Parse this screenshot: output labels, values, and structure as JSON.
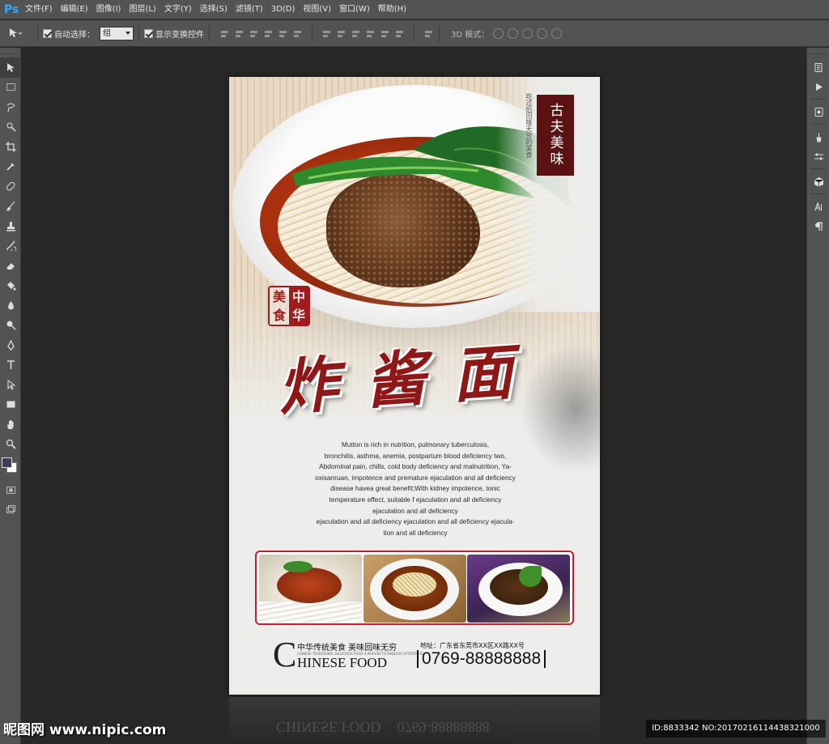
{
  "app": {
    "logo": "Ps"
  },
  "menu": [
    "文件(F)",
    "编辑(E)",
    "图像(I)",
    "图层(L)",
    "文字(Y)",
    "选择(S)",
    "滤镜(T)",
    "3D(D)",
    "视图(V)",
    "窗口(W)",
    "帮助(H)"
  ],
  "options": {
    "auto_select_label": "自动选择：",
    "auto_select_value": "组",
    "show_transform_label": "显示变换控件",
    "mode3d_label": "3D 模式："
  },
  "toolbar": {
    "icons": [
      "move-icon",
      "marquee-icon",
      "lasso-icon",
      "quick-select-icon",
      "crop-icon",
      "eyedropper-icon",
      "healing-icon",
      "brush-icon",
      "stamp-icon",
      "history-brush-icon",
      "eraser-icon",
      "bucket-icon",
      "blur-icon",
      "dodge-icon",
      "pen-icon",
      "type-icon",
      "path-select-icon",
      "rectangle-icon",
      "hand-icon",
      "zoom-icon"
    ]
  },
  "colors": {
    "foreground": "#3a3e57",
    "background": "#ffffff",
    "accent": "#8e1717"
  },
  "poster": {
    "vertical_label": "古夫美味",
    "vertical_tiny": "吃过后回味无穷的美食",
    "seal": [
      "美",
      "中",
      "食",
      "华"
    ],
    "title_chars": [
      "炸",
      "酱",
      "面"
    ],
    "body_lines": [
      "Mutton is rich in nutrition, pulmonary tuberculosis,",
      "bronchitis, asthma, anemia, postpartum blood deficiency two,",
      "Abdominal pain, chills, cold body deficiency and malnutrition, Ya-",
      "oxisanruan, impotence and premature ejaculation and all deficiency",
      "disease havea great benefit;With kidney impotence, tonic",
      "temperature effect, suitable f ejaculation and all deficiency",
      "ejaculation and all deficiency",
      "ejaculation and all deficiency  ejaculation and all deficiency  ejacula-",
      "tion and all deficiency"
    ],
    "footer": {
      "big_c": "C",
      "cn_slogan": "中华传统美食  美味回味无穷",
      "tiny": "CHINESE TRADITIONAL DELICIOUS FOOD A PERSON TO ENDLESS AFTERTASTE",
      "en": "HINESE FOOD",
      "address": "地址：广东省东莞市XX区XX路XX号",
      "phone": "0769-88888888"
    }
  },
  "reflection": {
    "left": "CHINESE FOOD",
    "right": "0769-88888888"
  },
  "watermark": {
    "site": "昵图网 www.nipic.com",
    "id": "ID:8833342 NO:20170216114438321000"
  }
}
